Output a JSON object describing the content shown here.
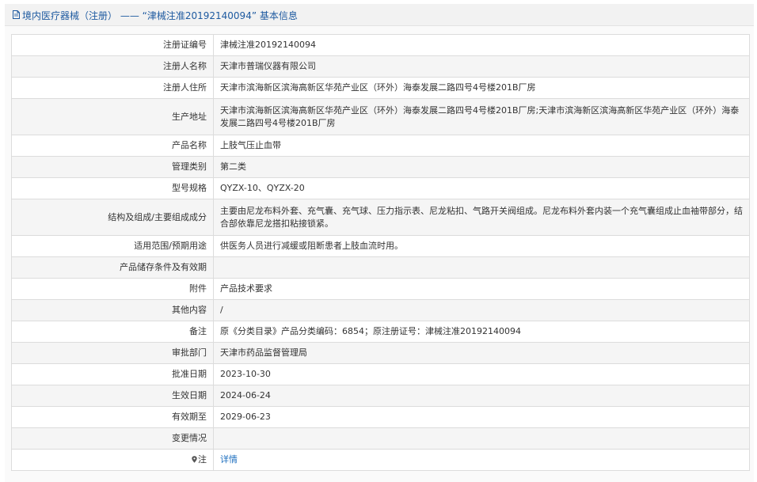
{
  "header": {
    "title": "境内医疗器械（注册） —— “津械注准20192140094” 基本信息"
  },
  "rows": [
    {
      "label": "注册证编号",
      "value": "津械注准20192140094"
    },
    {
      "label": "注册人名称",
      "value": "天津市普瑞仪器有限公司"
    },
    {
      "label": "注册人住所",
      "value": "天津市滨海新区滨海高新区华苑产业区（环外）海泰发展二路四号4号楼201B厂房"
    },
    {
      "label": "生产地址",
      "value": "天津市滨海新区滨海高新区华苑产业区（环外）海泰发展二路四号4号楼201B厂房;天津市滨海新区滨海高新区华苑产业区（环外）海泰发展二路四号4号楼201B厂房"
    },
    {
      "label": "产品名称",
      "value": "上肢气压止血带"
    },
    {
      "label": "管理类别",
      "value": "第二类"
    },
    {
      "label": "型号规格",
      "value": "QYZX-10、QYZX-20"
    },
    {
      "label": "结构及组成/主要组成成分",
      "value": "主要由尼龙布料外套、充气囊、充气球、压力指示表、尼龙粘扣、气路开关阀组成。尼龙布料外套内装一个充气囊组成止血袖带部分，结合部依靠尼龙搭扣粘接锁紧。"
    },
    {
      "label": "适用范围/预期用途",
      "value": "供医务人员进行减缓或阻断患者上肢血流时用。"
    },
    {
      "label": "产品储存条件及有效期",
      "value": ""
    },
    {
      "label": "附件",
      "value": "产品技术要求"
    },
    {
      "label": "其他内容",
      "value": "/"
    },
    {
      "label": "备注",
      "value": "原《分类目录》产品分类编码：6854；原注册证号：津械注准20192140094"
    },
    {
      "label": "审批部门",
      "value": "天津市药品监督管理局"
    },
    {
      "label": "批准日期",
      "value": "2023-10-30"
    },
    {
      "label": "生效日期",
      "value": "2024-06-24"
    },
    {
      "label": "有效期至",
      "value": "2029-06-23"
    },
    {
      "label": "变更情况",
      "value": ""
    },
    {
      "label": "注",
      "value": "详情"
    }
  ],
  "icons": {
    "header": "document-icon",
    "note": "map-pin-icon"
  },
  "colors": {
    "title": "#1e5aa0",
    "link": "#1e6fbf",
    "border": "#dcdcdc",
    "header_bg": "#f2f2f2"
  }
}
